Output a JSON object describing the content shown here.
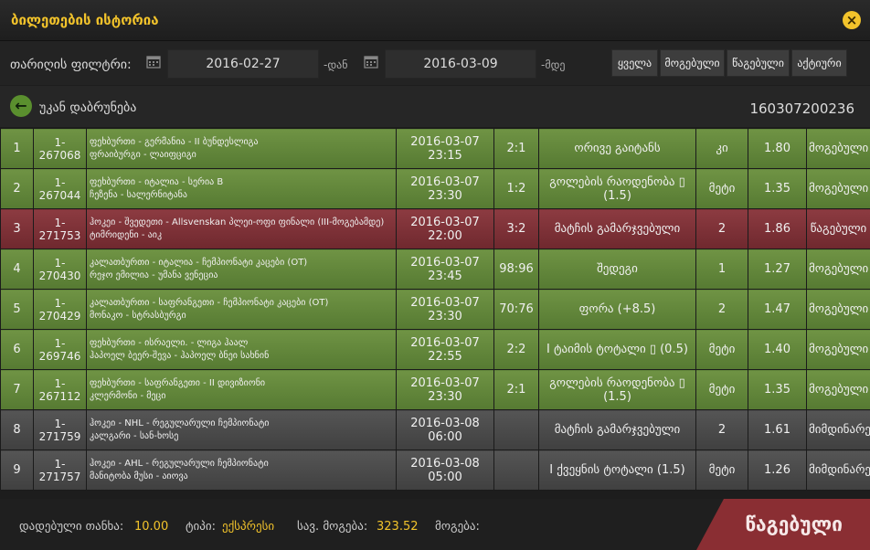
{
  "header": {
    "title": "ბილეთების ისტორია",
    "close_icon": "×"
  },
  "filter": {
    "label": "თარიღის ფილტრი:",
    "date_from": "2016-02-27",
    "from_suffix": "-დან",
    "date_to": "2016-03-09",
    "to_suffix": "-მდე",
    "buttons": [
      "ყველა",
      "მოგებული",
      "წაგებული",
      "აქტიური"
    ]
  },
  "back": {
    "label": "უკან დაბრუნება",
    "ticket_id": "160307200236"
  },
  "rows": [
    {
      "n": "1",
      "code": "1-267068",
      "event1": "ფეხბურთი - გერმანია - II ბუნდესლიგა",
      "event2": "ფრაიბურგი - ლაიფციგი",
      "date": "2016-03-07 23:15",
      "score": "2:1",
      "market": "ორივე გაიტანს",
      "pick": "კი",
      "odds": "1.80",
      "status": "მოგებული",
      "state": "won"
    },
    {
      "n": "2",
      "code": "1-267044",
      "event1": "ფეხბურთი - იტალია - სერია B",
      "event2": "ჩეზენა - სალერნიტანა",
      "date": "2016-03-07 23:30",
      "score": "1:2",
      "market": "გოლების რაოდენობა ▯ (1.5)",
      "pick": "მეტი",
      "odds": "1.35",
      "status": "მოგებული",
      "state": "won"
    },
    {
      "n": "3",
      "code": "1-271753",
      "event1": "ჰოკეი - შვედეთი - Allsvenskan პლეი-ოფი ფინალი (III-მოგებამდე)",
      "event2": "ტიმრიდენი - აიკ",
      "date": "2016-03-07 22:00",
      "score": "3:2",
      "market": "მატჩის გამარჯვებული",
      "pick": "2",
      "odds": "1.86",
      "status": "წაგებული",
      "state": "lost"
    },
    {
      "n": "4",
      "code": "1-270430",
      "event1": "კალათბურთი - იტალია - ჩემპიონატი კაცები (OT)",
      "event2": "რეჯო ემილია - უმანა ვენეცია",
      "date": "2016-03-07 23:45",
      "score": "98:96",
      "market": "შედეგი",
      "pick": "1",
      "odds": "1.27",
      "status": "მოგებული",
      "state": "won"
    },
    {
      "n": "5",
      "code": "1-270429",
      "event1": "კალათბურთი - საფრანგეთი - ჩემპიონატი კაცები (OT)",
      "event2": "მონაკო - სტრასბურგი",
      "date": "2016-03-07 23:30",
      "score": "70:76",
      "market": "ფორა (+8.5)",
      "pick": "2",
      "odds": "1.47",
      "status": "მოგებული",
      "state": "won"
    },
    {
      "n": "6",
      "code": "1-269746",
      "event1": "ფეხბურთი - ისრაელი. - ლიგა ჰაალ",
      "event2": "ჰაპოელ ბეერ-შევა - ჰაპოელ ბნეი სახნინ",
      "date": "2016-03-07 22:55",
      "score": "2:2",
      "market": "I ტაიმის ტოტალი ▯ (0.5)",
      "pick": "მეტი",
      "odds": "1.40",
      "status": "მოგებული",
      "state": "won"
    },
    {
      "n": "7",
      "code": "1-267112",
      "event1": "ფეხბურთი - საფრანგეთი - II დივიზიონი",
      "event2": "კლერმონი - მეცი",
      "date": "2016-03-07 23:30",
      "score": "2:1",
      "market": "გოლების რაოდენობა ▯ (1.5)",
      "pick": "მეტი",
      "odds": "1.35",
      "status": "მოგებული",
      "state": "won"
    },
    {
      "n": "8",
      "code": "1-271759",
      "event1": "ჰოკეი - NHL - რეგულარული ჩემპიონატი",
      "event2": "კალგარი - სან-ხოსე",
      "date": "2016-03-08 06:00",
      "score": "",
      "market": "მატჩის გამარჯვებული",
      "pick": "2",
      "odds": "1.61",
      "status": "მიმდინარე",
      "state": "pending"
    },
    {
      "n": "9",
      "code": "1-271757",
      "event1": "ჰოკეი - AHL - რეგულარული ჩემპიონატი",
      "event2": "მანიტობა მუსი - აიოვა",
      "date": "2016-03-08 05:00",
      "score": "",
      "market": "I ქვეყნის ტოტალი (1.5)",
      "pick": "მეტი",
      "odds": "1.26",
      "status": "მიმდინარე",
      "state": "pending"
    }
  ],
  "footer": {
    "stake_label": "დადებული თანხა:",
    "stake_value": "10.00",
    "type_label": "ტიპი:",
    "type_value": "ექსპრესი",
    "potential_label": "სავ. მოგება:",
    "potential_value": "323.52",
    "win_label": "მოგება:",
    "result": "წაგებული"
  },
  "colors": {
    "accent": "#f2c32b",
    "won": "#65883d",
    "lost": "#7d3238",
    "pending": "#4a4a4a"
  }
}
